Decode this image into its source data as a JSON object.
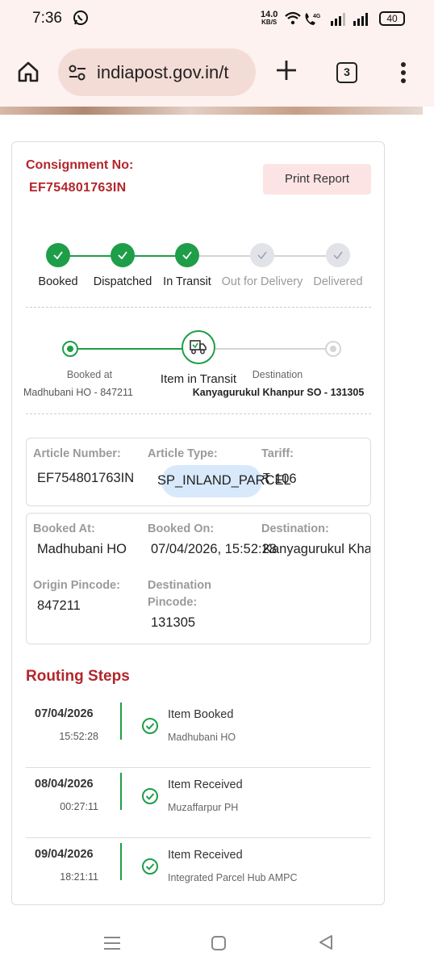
{
  "status_bar": {
    "time": "7:36",
    "speed_value": "14.0",
    "speed_unit": "KB/S",
    "battery": "40"
  },
  "browser": {
    "url": "indiapost.gov.in/t",
    "tab_count": "3"
  },
  "consignment": {
    "label": "Consignment No:",
    "number": "EF754801763IN",
    "print_label": "Print Report"
  },
  "progress_steps": [
    {
      "label": "Booked",
      "state": "done"
    },
    {
      "label": "Dispatched",
      "state": "done"
    },
    {
      "label": "In Transit",
      "state": "done"
    },
    {
      "label": "Out for Delivery",
      "state": "todo"
    },
    {
      "label": "Delivered",
      "state": "todo"
    }
  ],
  "route": {
    "origin_label": "Booked at",
    "origin_value": "Madhubani HO - 847211",
    "current_label": "Item in Transit",
    "destination_label": "Destination",
    "destination_value": "Kanyagurukul Khanpur SO - 131305"
  },
  "article": {
    "number_label": "Article Number:",
    "number_value": "EF754801763IN",
    "type_label": "Article Type:",
    "type_value": "SP_INLAND_PARCEL",
    "tariff_label": "Tariff:",
    "tariff_value": "₹ 106"
  },
  "booking": {
    "booked_at_label": "Booked At:",
    "booked_at_value": "Madhubani HO",
    "booked_on_label": "Booked On:",
    "booked_on_value": "07/04/2026, 15:52:28",
    "destination_label": "Destination:",
    "destination_value": "Kanyagurukul Khanpur SO",
    "origin_pincode_label": "Origin Pincode:",
    "origin_pincode_value": "847211",
    "dest_pincode_label_1": "Destination",
    "dest_pincode_label_2": "Pincode:",
    "dest_pincode_value": "131305"
  },
  "routing": {
    "title": "Routing Steps",
    "steps": [
      {
        "date": "07/04/2026",
        "time": "15:52:28",
        "event": "Item Booked",
        "location": "Madhubani HO"
      },
      {
        "date": "08/04/2026",
        "time": "00:27:11",
        "event": "Item Received",
        "location": "Muzaffarpur PH"
      },
      {
        "date": "09/04/2026",
        "time": "18:21:11",
        "event": "Item Received",
        "location": "Integrated Parcel Hub AMPC"
      }
    ]
  },
  "colors": {
    "accent_red": "#b3262b",
    "success_green": "#1e9e48",
    "pending_grey": "#e2e3e8",
    "pill_blue": "#d8e9fb"
  }
}
